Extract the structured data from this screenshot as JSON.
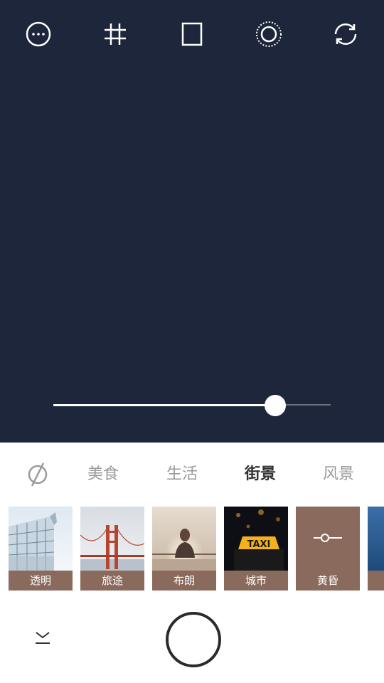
{
  "top_toolbar": {
    "icons": [
      "more-icon",
      "grid-icon",
      "aspect-ratio-icon",
      "timer-icon",
      "switch-camera-icon"
    ]
  },
  "exposure_slider": {
    "value_fraction": 0.8
  },
  "category_tabs": {
    "none_icon": "no-filter-icon",
    "items": [
      {
        "label": "美食",
        "active": false
      },
      {
        "label": "生活",
        "active": false
      },
      {
        "label": "街景",
        "active": true
      },
      {
        "label": "风景",
        "active": false
      }
    ]
  },
  "filters": {
    "items": [
      {
        "label": "透明",
        "icon": "building-thumbnail"
      },
      {
        "label": "旅途",
        "icon": "bridge-thumbnail"
      },
      {
        "label": "布朗",
        "icon": "woman-thumbnail"
      },
      {
        "label": "城市",
        "icon": "taxi-thumbnail"
      },
      {
        "label": "黄昏",
        "icon": "adjust-icon",
        "selected": true
      }
    ],
    "taxi_sign_text": "TAXI"
  },
  "colors": {
    "viewfinder_bg": "#1d263a",
    "filter_label_bg": "#8a6a5c",
    "active_tab": "#333333",
    "inactive_tab": "#9a9a9a"
  },
  "bottom_controls": {
    "shutter": "shutter-button",
    "collapse": "chevron-down-icon"
  }
}
